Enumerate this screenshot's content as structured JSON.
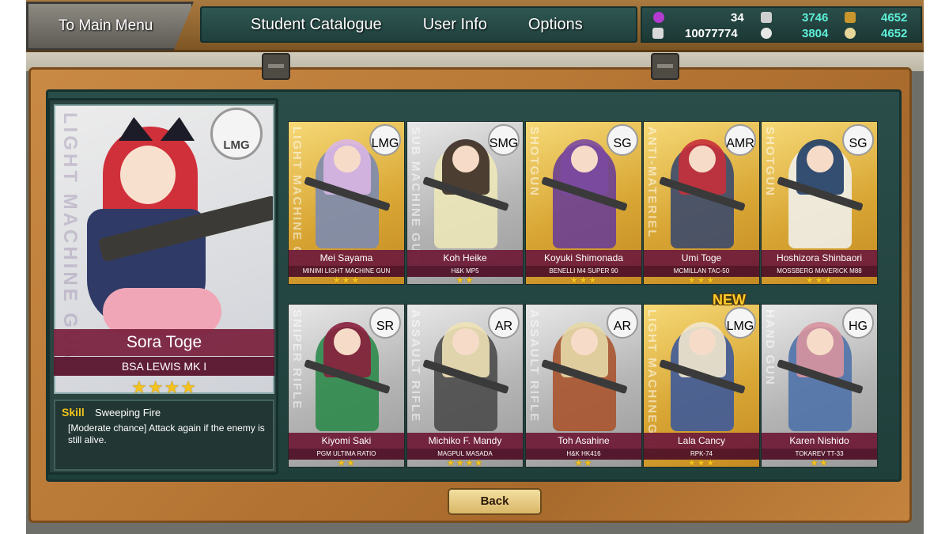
{
  "header": {
    "main_menu_label": "To Main Menu",
    "nav": [
      "Student Catalogue",
      "User Info",
      "Options"
    ]
  },
  "resources": {
    "count_a": "34",
    "count_b": "10077774",
    "count_c": "3746",
    "count_d": "3804",
    "count_e": "4652",
    "count_f": "4652"
  },
  "featured": {
    "class_badge": "LMG",
    "class_vertical": "LIGHT MACHINE GUN",
    "name": "Sora Toge",
    "weapon": "BSA LEWIS MK I",
    "stars": "★★★★",
    "skill_label": "Skill",
    "skill_name": "Sweeping Fire",
    "skill_desc": "[Moderate chance] Attack again if the enemy is still alive."
  },
  "cards": [
    {
      "name": "Mei Sayama",
      "weapon": "MINIMI LIGHT MACHINE GUN",
      "badge": "LMG",
      "vertical": "LIGHT MACHINE GUN",
      "stars": "★★★",
      "tier": "gold",
      "hair": "#d9b6e6",
      "outfit": "#7c8bb0"
    },
    {
      "name": "Koh Heike",
      "weapon": "H&K MP5",
      "badge": "SMG",
      "vertical": "SUB MACHINE GUN",
      "stars": "★★",
      "tier": "silver",
      "hair": "#3b2b22",
      "outfit": "#ece7b8"
    },
    {
      "name": "Koyuki Shimonada",
      "weapon": "BENELLI M4 SUPER 90",
      "badge": "SG",
      "vertical": "SHOTGUN",
      "stars": "★★★",
      "tier": "gold",
      "hair": "#7b4aa0",
      "outfit": "#6a3f94"
    },
    {
      "name": "Umi Toge",
      "weapon": "MCMILLAN TAC-50",
      "badge": "AMR",
      "vertical": "ANTI-MATERIEL",
      "stars": "★★★",
      "tier": "gold",
      "hair": "#c8303a",
      "outfit": "#3c4a6b"
    },
    {
      "name": "Hoshizora Shinbaori",
      "weapon": "MOSSBERG MAVERICK M88",
      "badge": "SG",
      "vertical": "SHOTGUN",
      "stars": "★★★",
      "tier": "gold",
      "hair": "#1f3d66",
      "outfit": "#f0f0ea"
    },
    {
      "name": "Kiyomi Saki",
      "weapon": "PGM ULTIMA RATIO",
      "badge": "SR",
      "vertical": "SNIPER RIFLE",
      "stars": "★★",
      "tier": "silver",
      "hair": "#8a1f3c",
      "outfit": "#2f8a4c"
    },
    {
      "name": "Michiko F. Mandy",
      "weapon": "MAGPUL MASADA",
      "badge": "AR",
      "vertical": "ASSAULT RIFLE",
      "stars": "★★★★",
      "tier": "silver",
      "hair": "#efe2b6",
      "outfit": "#4b4b4b"
    },
    {
      "name": "Toh Asahine",
      "weapon": "H&K HK416",
      "badge": "AR",
      "vertical": "ASSAULT RIFLE",
      "stars": "★★",
      "tier": "silver",
      "hair": "#e6d9a8",
      "outfit": "#a8542d"
    },
    {
      "name": "Lala Cancy",
      "weapon": "RPK-74",
      "badge": "LMG",
      "vertical": "LIGHT MACHINEGUN",
      "stars": "★★★",
      "tier": "gold",
      "hair": "#f2e7cf",
      "outfit": "#3e5a9a"
    },
    {
      "name": "Karen Nishido",
      "weapon": "TOKAREV TT-33",
      "badge": "HG",
      "vertical": "HAND GUN",
      "stars": "★★",
      "tier": "silver",
      "hair": "#d8949e",
      "outfit": "#4f72a8"
    }
  ],
  "new_tag": "NEW",
  "back_label": "Back",
  "colors": {
    "wood": "#b87836",
    "panel_teal": "#24453f",
    "name_bar": "#701e3a",
    "star": "#f3c21c",
    "accent_cyan": "#5ff0d8"
  }
}
